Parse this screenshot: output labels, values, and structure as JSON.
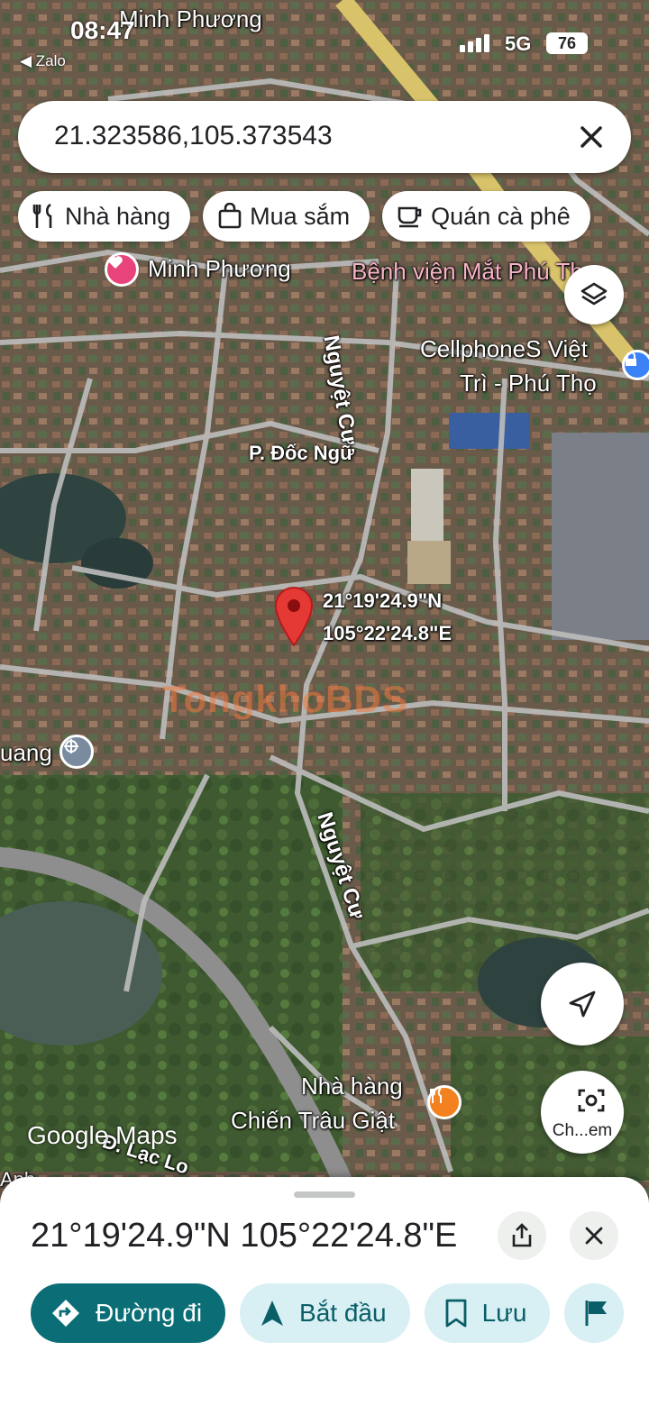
{
  "status_bar": {
    "time": "08:47",
    "back_app": "◀ Zalo",
    "network": "5G",
    "battery": "76"
  },
  "search": {
    "value": "21.323586,105.373543",
    "clear_icon": "close-icon"
  },
  "chips": [
    {
      "label": "Nhà hàng",
      "icon": "restaurant-icon"
    },
    {
      "label": "Mua sắm",
      "icon": "shopping-bag-icon"
    },
    {
      "label": "Quán cà phê",
      "icon": "coffee-icon"
    }
  ],
  "map": {
    "places": {
      "minh_phuong_top": "Minh Phương",
      "minh_phuong": "Minh Phương",
      "benh_vien": "Bệnh viện Mắt Phú Thọ",
      "cellphones_1": "CellphoneS Việt",
      "cellphones_2": "Trì - Phú Thọ",
      "doc_ngu": "P. Đốc Ngữ",
      "nguyet_cu_1": "Nguyệt Cư",
      "nguyet_cu_2": "Nguyệt Cư",
      "uang": "uang",
      "nha_hang_1": "Nhà hàng",
      "nha_hang_2": "Chiến Trâu Giật",
      "lac_long": "Đ. Lạc Lo",
      "anh": "Anh",
      "pin_lat": "21°19'24.9\"N",
      "pin_lng": "105°22'24.8\"E"
    },
    "attribution": "Google Maps",
    "watermark": "TongkhoBDS"
  },
  "controls": {
    "lens_label": "Ch...em"
  },
  "sheet": {
    "title": "21°19'24.9\"N 105°22'24.8\"E",
    "actions": [
      {
        "label": "Đường đi",
        "icon": "directions-icon"
      },
      {
        "label": "Bắt đầu",
        "icon": "navigation-arrow-icon"
      },
      {
        "label": "Lưu",
        "icon": "bookmark-icon"
      }
    ]
  },
  "colors": {
    "primary": "#0b6e77",
    "secondary_bg": "#d8f0f3",
    "pin": "#e53935",
    "poi_pink": "#e8437a",
    "poi_orange": "#f4811f",
    "poi_blue": "#3b82f6"
  }
}
